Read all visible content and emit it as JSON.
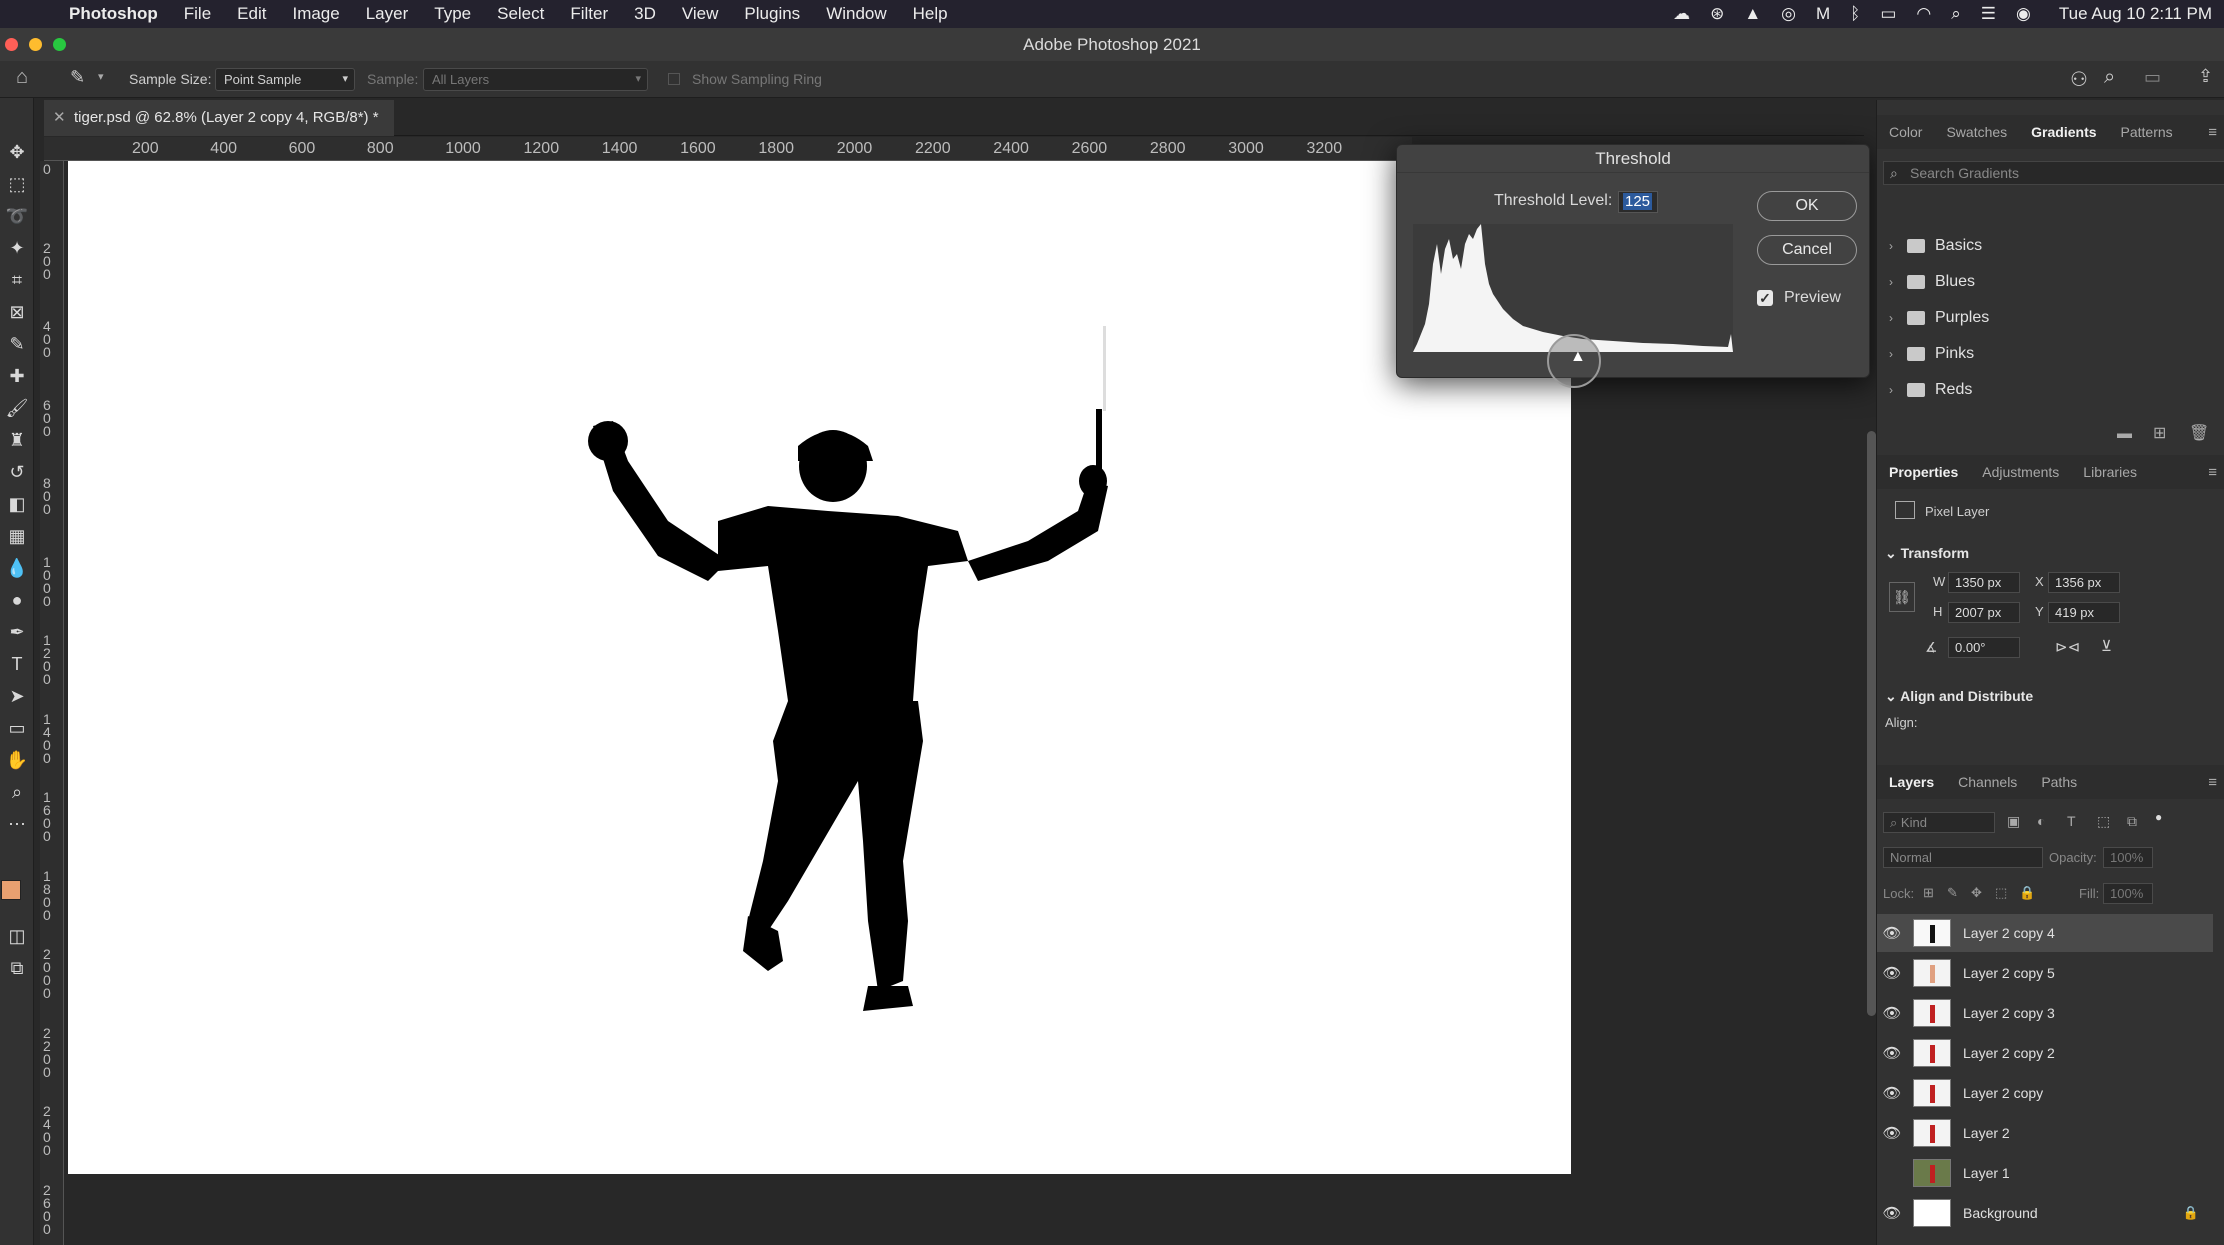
{
  "menubar": {
    "apple": "",
    "items": [
      "Photoshop",
      "File",
      "Edit",
      "Image",
      "Layer",
      "Type",
      "Select",
      "Filter",
      "3D",
      "View",
      "Plugins",
      "Window",
      "Help"
    ],
    "clock": "Tue Aug 10  2:11 PM"
  },
  "window": {
    "title": "Adobe Photoshop 2021"
  },
  "options_bar": {
    "sample_size_label": "Sample Size:",
    "sample_size_value": "Point Sample",
    "sample_label": "Sample:",
    "sample_value": "All Layers",
    "show_ring_label": "Show Sampling Ring"
  },
  "document": {
    "tab_title": "tiger.psd @ 62.8% (Layer 2 copy 4, RGB/8*) *"
  },
  "ruler": {
    "h_labels": [
      "200",
      "400",
      "600",
      "800",
      "1000",
      "1200",
      "1400",
      "1600",
      "1800",
      "2000",
      "2200",
      "2400",
      "2600",
      "2800",
      "3000",
      "3200"
    ],
    "v_labels": [
      "0",
      "200",
      "400",
      "600",
      "800",
      "1000",
      "1200",
      "1400",
      "1600",
      "1800",
      "2000",
      "2200",
      "2400",
      "2600"
    ]
  },
  "threshold_dialog": {
    "title": "Threshold",
    "level_label": "Threshold Level:",
    "level_value": "125",
    "ok": "OK",
    "cancel": "Cancel",
    "preview_label": "Preview",
    "preview_checked": true,
    "slider_fraction": 0.49
  },
  "gradients_panel": {
    "tabs": [
      "Color",
      "Swatches",
      "Gradients",
      "Patterns"
    ],
    "active_tab": "Gradients",
    "search_placeholder": "Search Gradients",
    "folders": [
      "Basics",
      "Blues",
      "Purples",
      "Pinks",
      "Reds"
    ]
  },
  "properties_panel": {
    "tabs": [
      "Properties",
      "Adjustments",
      "Libraries"
    ],
    "layer_kind": "Pixel Layer",
    "transform_title": "Transform",
    "w_label": "W",
    "w_value": "1350 px",
    "x_label": "X",
    "x_value": "1356 px",
    "h_label": "H",
    "h_value": "2007 px",
    "y_label": "Y",
    "y_value": "419 px",
    "angle_value": "0.00°",
    "align_title": "Align and Distribute",
    "align_label": "Align:"
  },
  "layers_panel": {
    "tabs": [
      "Layers",
      "Channels",
      "Paths"
    ],
    "kind_placeholder": "Kind",
    "blend_mode": "Normal",
    "opacity_label": "Opacity:",
    "opacity_value": "100%",
    "lock_label": "Lock:",
    "fill_label": "Fill:",
    "fill_value": "100%",
    "layers": [
      {
        "name": "Layer 2 copy 4",
        "visible": true,
        "selected": true
      },
      {
        "name": "Layer 2 copy 5",
        "visible": true,
        "selected": false
      },
      {
        "name": "Layer 2 copy 3",
        "visible": true,
        "selected": false
      },
      {
        "name": "Layer 2 copy 2",
        "visible": true,
        "selected": false
      },
      {
        "name": "Layer 2 copy",
        "visible": true,
        "selected": false
      },
      {
        "name": "Layer 2",
        "visible": true,
        "selected": false
      },
      {
        "name": "Layer 1",
        "visible": false,
        "selected": false
      },
      {
        "name": "Background",
        "visible": true,
        "selected": false
      }
    ]
  },
  "colors": {
    "foreground": "#e8a070",
    "background": "#d4c000",
    "accent": "#2c5a9c"
  }
}
